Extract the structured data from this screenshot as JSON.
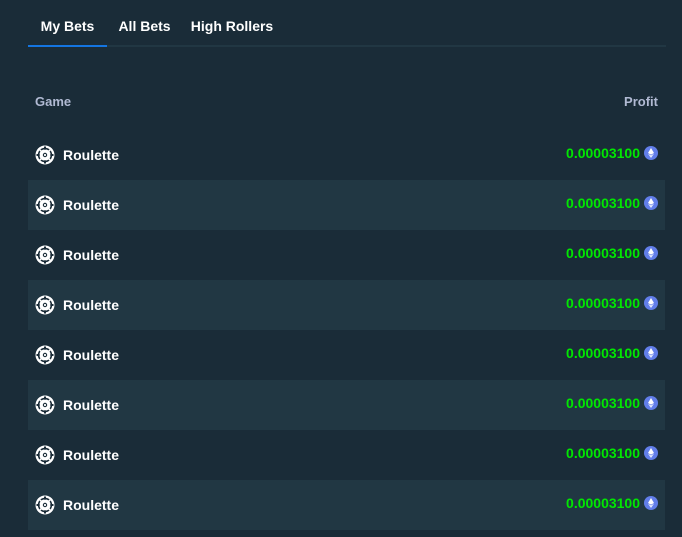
{
  "tabs": [
    {
      "label": "My Bets",
      "active": true
    },
    {
      "label": "All Bets",
      "active": false
    },
    {
      "label": "High Rollers",
      "active": false
    }
  ],
  "table": {
    "headers": {
      "game": "Game",
      "profit": "Profit"
    },
    "rows": [
      {
        "game": "Roulette",
        "game_icon": "roulette-icon",
        "profit": "0.00003100",
        "currency_icon": "ethereum-icon"
      },
      {
        "game": "Roulette",
        "game_icon": "roulette-icon",
        "profit": "0.00003100",
        "currency_icon": "ethereum-icon"
      },
      {
        "game": "Roulette",
        "game_icon": "roulette-icon",
        "profit": "0.00003100",
        "currency_icon": "ethereum-icon"
      },
      {
        "game": "Roulette",
        "game_icon": "roulette-icon",
        "profit": "0.00003100",
        "currency_icon": "ethereum-icon"
      },
      {
        "game": "Roulette",
        "game_icon": "roulette-icon",
        "profit": "0.00003100",
        "currency_icon": "ethereum-icon"
      },
      {
        "game": "Roulette",
        "game_icon": "roulette-icon",
        "profit": "0.00003100",
        "currency_icon": "ethereum-icon"
      },
      {
        "game": "Roulette",
        "game_icon": "roulette-icon",
        "profit": "0.00003100",
        "currency_icon": "ethereum-icon"
      },
      {
        "game": "Roulette",
        "game_icon": "roulette-icon",
        "profit": "0.00003100",
        "currency_icon": "ethereum-icon"
      }
    ]
  },
  "colors": {
    "background": "#1a2c38",
    "row_alt": "#213743",
    "active_tab_underline": "#1475e1",
    "profit_positive": "#00e701",
    "header_text": "#b1bad3",
    "coin": "#627eea"
  }
}
